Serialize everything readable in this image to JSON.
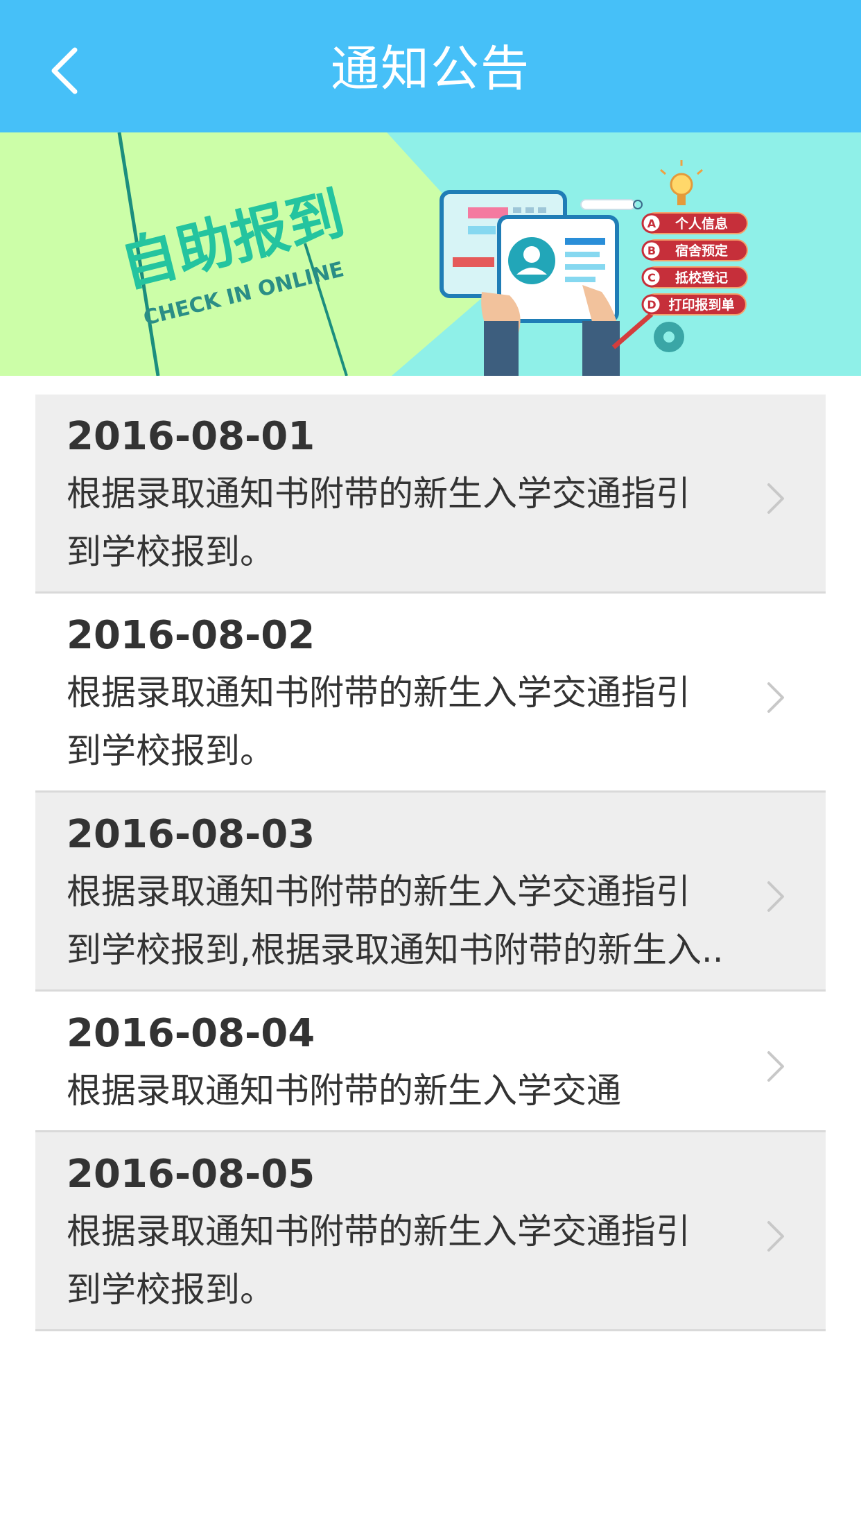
{
  "header": {
    "title": "通知公告",
    "back_icon": "chevron-left-icon",
    "bg_color": "#46c0f8"
  },
  "banner": {
    "title": "自助报到",
    "subtitle": "CHECK IN ONLINE",
    "steps": [
      {
        "letter": "A",
        "label": "个人信息"
      },
      {
        "letter": "B",
        "label": "宿舍预定"
      },
      {
        "letter": "C",
        "label": "抵校登记"
      },
      {
        "letter": "D",
        "label": "打印报到单"
      }
    ]
  },
  "notices": [
    {
      "date": "2016-08-01",
      "lines": [
        "根据录取通知书附带的新生入学交通指引",
        "到学校报到。"
      ]
    },
    {
      "date": "2016-08-02",
      "lines": [
        "根据录取通知书附带的新生入学交通指引",
        "到学校报到。"
      ]
    },
    {
      "date": "2016-08-03",
      "lines": [
        "根据录取通知书附带的新生入学交通指引",
        "到学校报到,根据录取通知书附带的新生入.."
      ]
    },
    {
      "date": "2016-08-04",
      "lines": [
        "根据录取通知书附带的新生入学交通"
      ]
    },
    {
      "date": "2016-08-05",
      "lines": [
        "根据录取通知书附带的新生入学交通指引",
        "到学校报到。"
      ]
    }
  ],
  "colors": {
    "row_gray": "#eeeeee",
    "row_white": "#ffffff",
    "divider": "#d9d9d9",
    "text": "#333333",
    "chevron": "#c8c8c8"
  }
}
